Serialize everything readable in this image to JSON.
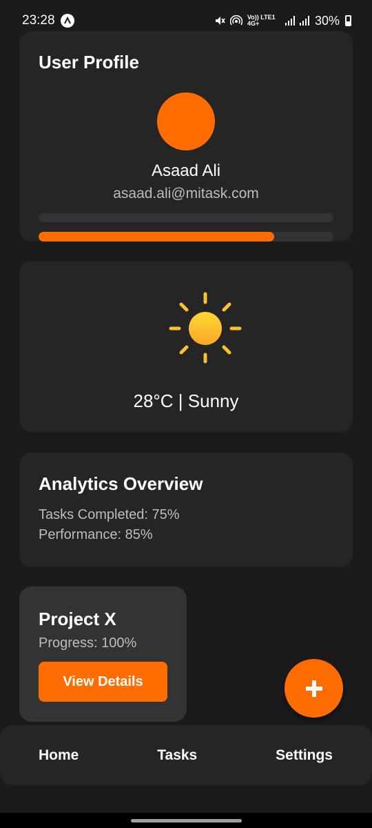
{
  "status_bar": {
    "time": "23:28",
    "network_label": "Vo)) LTE1 4G+",
    "battery": "30%"
  },
  "profile": {
    "title": "User Profile",
    "name": "Asaad Ali",
    "email": "asaad.ali@mitask.com",
    "progress": 0.8,
    "accent_color": "#ff6d00"
  },
  "weather": {
    "icon": "sun-icon",
    "text": "28°C | Sunny"
  },
  "analytics": {
    "title": "Analytics Overview",
    "tasks_completed": "Tasks Completed: 75%",
    "performance": "Performance: 85%"
  },
  "project": {
    "title": "Project X",
    "progress": "Progress: 100%",
    "button_label": "View Details"
  },
  "fab": {
    "icon": "plus-icon"
  },
  "bottom_nav": {
    "items": [
      "Home",
      "Tasks",
      "Settings"
    ]
  },
  "colors": {
    "background": "#1b1b1b",
    "card": "#252525",
    "accent": "#ff6d00",
    "sun": "#fbc02d"
  }
}
